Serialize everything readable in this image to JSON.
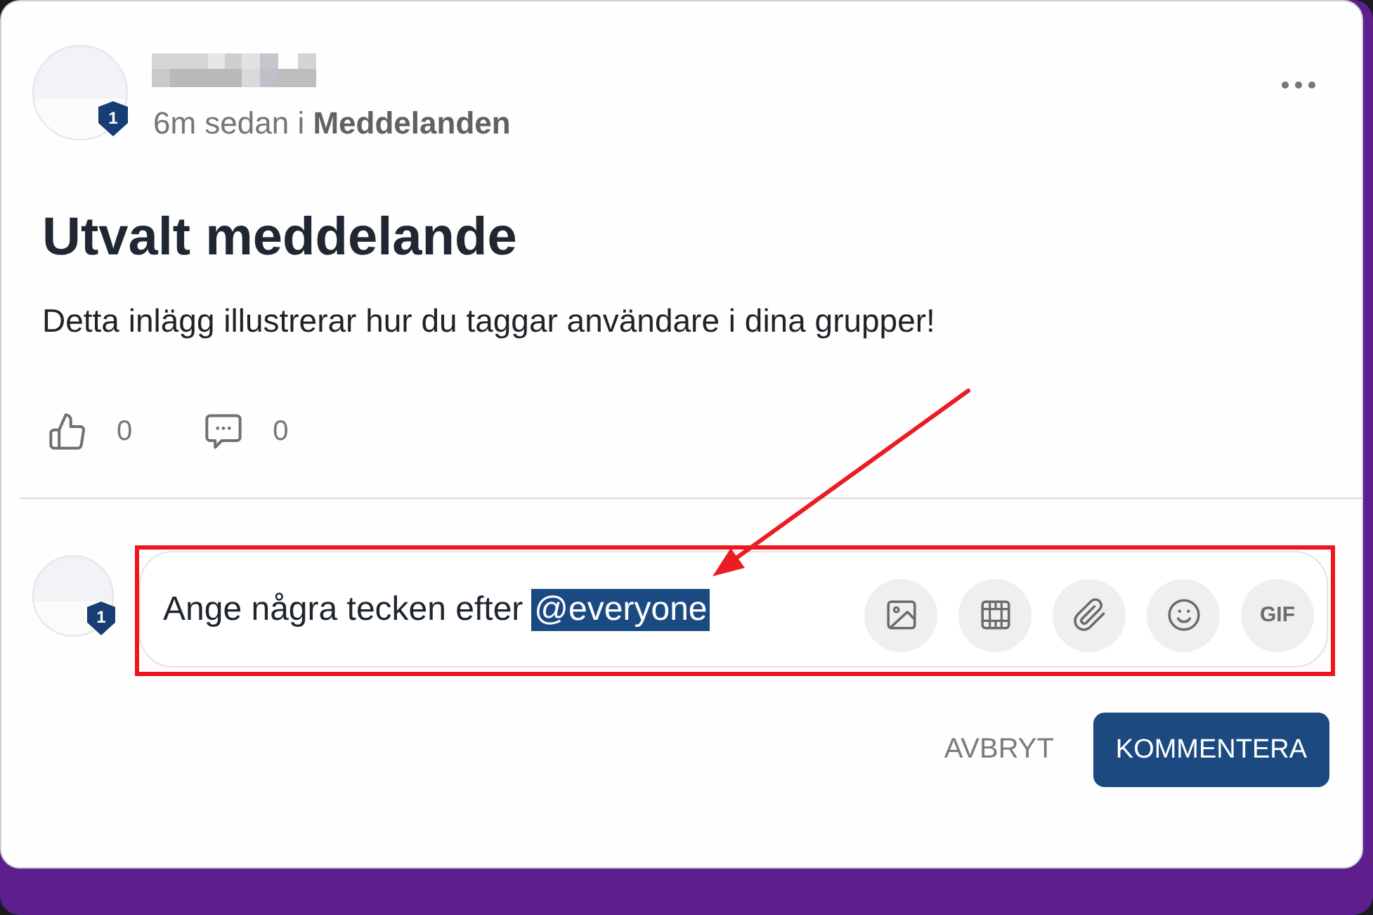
{
  "post": {
    "author": {
      "badge": "1"
    },
    "meta": "6m sedan i **Meddelanden**",
    "title": "Utvalt meddelande",
    "body": "Detta inlägg illustrerar hur du taggar användare i dina grupper!",
    "reactions": [
      {
        "kind": "like",
        "count": "0"
      },
      {
        "kind": "comment",
        "count": "0"
      }
    ]
  },
  "comment_box": {
    "avatar_badge": "1",
    "value_parts": [
      {
        "text": "Ange några tecken efter",
        "selected": false
      },
      {
        "text": "@everyone",
        "selected": true
      }
    ],
    "tools": [
      {
        "kind": "image"
      },
      {
        "kind": "video"
      },
      {
        "kind": "attachment"
      },
      {
        "kind": "emoji"
      },
      {
        "kind": "gif",
        "label": "GIF"
      }
    ]
  },
  "actions": {
    "cancel": "AVBRYT",
    "submit": "KOMMENTERA"
  }
}
